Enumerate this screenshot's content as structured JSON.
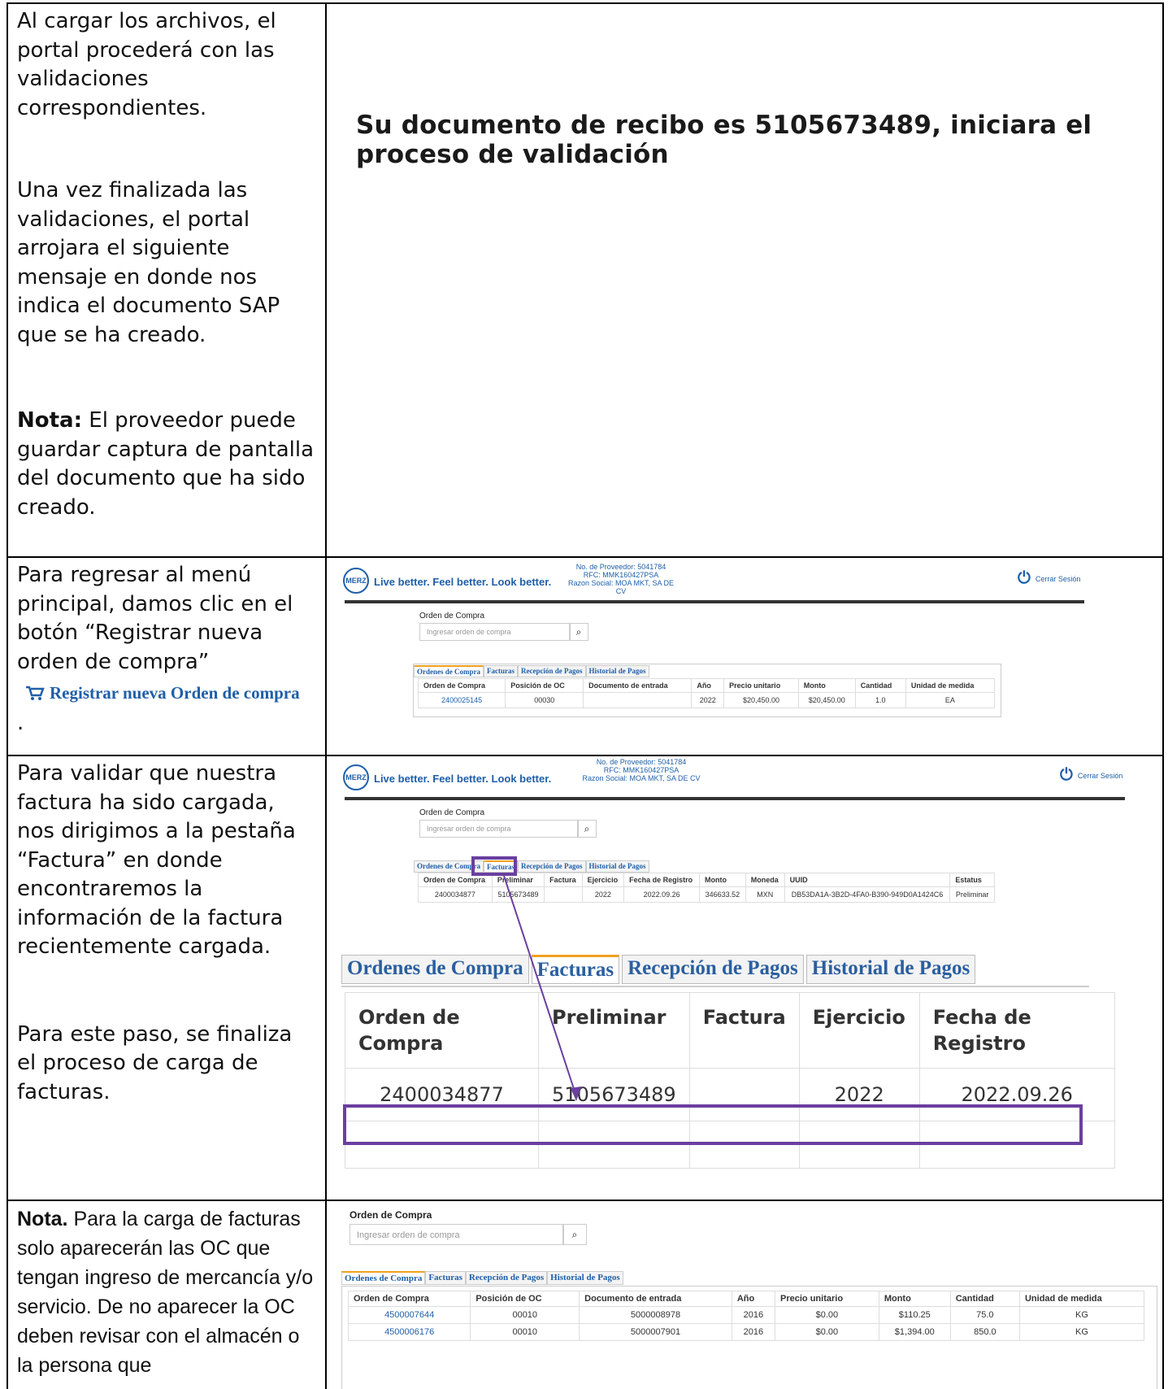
{
  "row1": {
    "p1": "Al cargar los archivos, el portal procederá con las validaciones correspondientes.",
    "p2": "Una vez finalizada las validaciones, el portal arrojara el siguiente mensaje en donde nos indica el documento SAP que se ha creado.",
    "nota_label": "Nota:",
    "nota_text": " El proveedor puede guardar captura de pantalla del documento que ha sido creado.",
    "message_line1": "Su documento de recibo es 5105673489, iniciara el",
    "message_line2": "proceso de validación"
  },
  "row2": {
    "p1": "Para regresar al menú principal, damos clic en el botón “Registrar nueva orden de compra”",
    "link_label": "Registrar nueva Orden de compra",
    "dot": "."
  },
  "row3": {
    "p1": "Para validar que nuestra factura ha sido cargada, nos dirigimos a la pestaña “Factura” en donde encontraremos la información de la factura recientemente cargada.",
    "p2": "Para este paso, se finaliza el proceso de carga de facturas."
  },
  "row4": {
    "nota_label": "Nota.",
    "nota_text": " Para la carga de facturas solo aparecerán las OC que tengan ingreso de mercancía y/o servicio.  De no aparecer la OC deben revisar con el almacén o la persona que"
  },
  "app": {
    "logo": "MERZ",
    "tagline": "Live better. Feel better. Look better.",
    "prov_no": "No. de Proveedor: 5041784",
    "rfc": "RFC: MMK160427PSA",
    "razon": "Razon Social: MOA MKT, SA DE CV",
    "logout": "Cerrar Sesión",
    "oc_label": "Orden de Compra",
    "search_placeholder": "Ingresar orden de compra",
    "tabs": [
      "Ordenes de Compra",
      "Facturas",
      "Recepción de Pagos",
      "Historial de Pagos"
    ]
  },
  "oc_table": {
    "headers": [
      "Orden de Compra",
      "Posición de OC",
      "Documento de entrada",
      "Año",
      "Precio unitario",
      "Monto",
      "Cantidad",
      "Unidad de medida"
    ],
    "row": [
      "2400025145",
      "00030",
      "",
      "2022",
      "$20,450.00",
      "$20,450.00",
      "1.0",
      "EA"
    ]
  },
  "fact_table": {
    "headers": [
      "Orden de Compra",
      "Preliminar",
      "Factura",
      "Ejercicio",
      "Fecha de Registro",
      "Monto",
      "Moneda",
      "UUID",
      "Estatus"
    ],
    "row": [
      "2400034877",
      "5105673489",
      "",
      "2022",
      "2022.09.26",
      "346633.52",
      "MXN",
      "DB53DA1A-3B2D-4FA0-B390-949D0A1424C6",
      "Preliminar"
    ]
  },
  "zoom": {
    "tabs": [
      "Ordenes de Compra",
      "Facturas",
      "Recepción de Pagos",
      "Historial de Pagos"
    ],
    "headers": [
      "Orden de Compra",
      "Preliminar",
      "Factura",
      "Ejercicio",
      "Fecha de Registro"
    ],
    "row": [
      "2400034877",
      "5105673489",
      "",
      "2022",
      "2022.09.26"
    ]
  },
  "oc_table2": {
    "headers": [
      "Orden de Compra",
      "Posición de OC",
      "Documento de entrada",
      "Año",
      "Precio unitario",
      "Monto",
      "Cantidad",
      "Unidad de medida"
    ],
    "rows": [
      [
        "4500007644",
        "00010",
        "5000008978",
        "2016",
        "$0.00",
        "$110.25",
        "75.0",
        "KG"
      ],
      [
        "4500006176",
        "00010",
        "5000007901",
        "2016",
        "$0.00",
        "$1,394.00",
        "850.0",
        "KG"
      ]
    ]
  },
  "colors": {
    "accent": "#1f5fa8",
    "highlight": "#6a3fa0",
    "tab_active": "#f0a020"
  }
}
